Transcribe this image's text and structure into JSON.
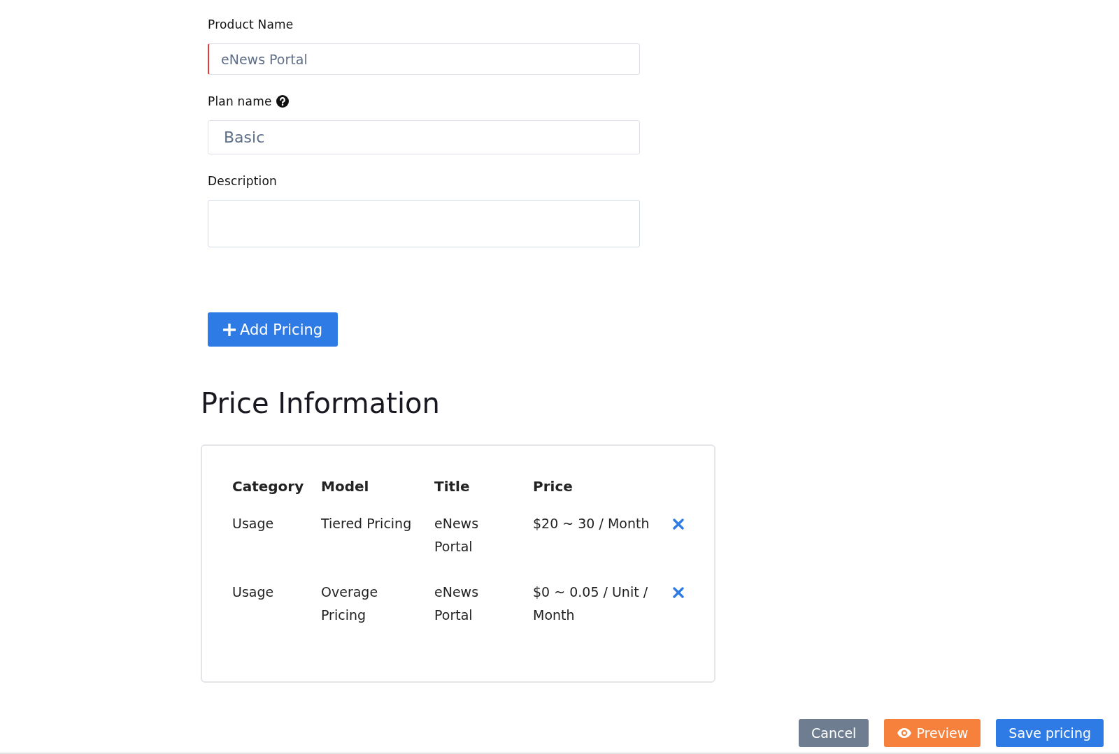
{
  "form": {
    "fields": [
      {
        "kind": "input",
        "label": "Product Name",
        "value": "eNews Portal",
        "invalid": true,
        "help": false
      },
      {
        "kind": "input",
        "label": "Plan name",
        "value": "Basic",
        "invalid": false,
        "help": true
      },
      {
        "kind": "textarea",
        "label": "Description",
        "invalid": false,
        "help": false
      }
    ],
    "add_button": {
      "label": "Add Pricing"
    }
  },
  "price_information": {
    "title": "Price Information",
    "table": {
      "columns": [
        "Category",
        "Model",
        "Title",
        "Price"
      ],
      "rows": [
        {
          "category": "Usage",
          "model": "Tiered Pricing",
          "title": "eNews Portal",
          "price": "$20 ~ 30 / Month"
        },
        {
          "category": "Usage",
          "model": "Overage Pricing",
          "title": "eNews Portal",
          "price": "$0 ~ 0.05 / Unit / Month"
        }
      ]
    }
  },
  "footer_buttons": [
    {
      "kind": "secondary",
      "label": "Cancel"
    },
    {
      "kind": "preview",
      "label": "Preview"
    },
    {
      "kind": "primary",
      "label": "Save pricing"
    }
  ]
}
